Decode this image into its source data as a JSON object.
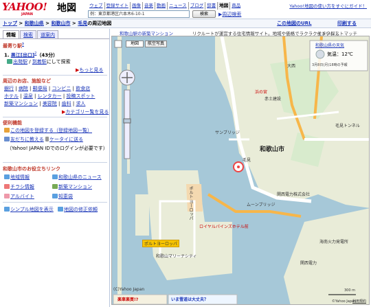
{
  "header": {
    "logo_text": "YAHOO!",
    "logo_sub": "JAPAN",
    "service": "地図",
    "nav": [
      "ウェブ",
      "登録サイト",
      "画像",
      "音楽",
      "動画",
      "ニュース",
      "ブログ",
      "辞書",
      "地図",
      "商品"
    ],
    "nav_current": "地図",
    "help_link": "Yahoo!地図の使い方をすぐにガイド！",
    "search_placeholder": "例：東京都港区六本木6-10-1",
    "search_button": "検索",
    "search_link": "周辺検索"
  },
  "breadcrumb": {
    "items": [
      "トップ",
      "和歌山県",
      "和歌山市",
      "毛見"
    ],
    "current": "の周辺地図"
  },
  "toolbar": {
    "url_button": "この地図のURL",
    "print_button": "印刷する"
  },
  "left": {
    "tabs": [
      "情報",
      "検索",
      "道案内"
    ],
    "station": {
      "heading": "最寄り駅",
      "help": "?",
      "item_num": "1.",
      "item_name": "黒江[出口]",
      "item_badge": "2",
      "item_time": "（43分）",
      "depart": "出発駅",
      "arrive": "到着駅",
      "suffix": "にして探索",
      "more": "もっと見る"
    },
    "nearby": {
      "heading": "周辺のお店、施設など",
      "links": [
        [
          "銀行",
          "病院",
          "郵便局",
          "コンビニ",
          "飲食店"
        ],
        [
          "ホテル",
          "温泉",
          "レンタカー",
          "投稿スポット"
        ],
        [
          "新築マンション",
          "美容院",
          "歯科",
          "求人"
        ]
      ],
      "more": "カテゴリー覧を見る"
    },
    "tools": {
      "heading": "便利機能",
      "register": "この地図を登録する",
      "register_list": "（登録地図一覧）",
      "tell_friend": "友だちに教える",
      "send_mobile": "ケータイに送る",
      "note": "（Yahoo! JAPAN IDでのログインが必要です）"
    },
    "links": {
      "heading": "和歌山市のお役立ちリンク",
      "items": [
        "地域情報",
        "和歌山県のニュース",
        "チラシ情報",
        "新築マンション",
        "アルバイト",
        "知恵袋"
      ],
      "simple_map": "シンプル地図を表示",
      "report": "地図の修正依頼"
    }
  },
  "map": {
    "ad_label": "和歌山駅の新築マンション",
    "ad_text": "リクルートが運営する住宅情報サイト。地域や価格でラクラク住まい探し",
    "ad_tag": "インタレストマッチ",
    "btn_map": "地図",
    "btn_photo": "航空写真",
    "weather_title": "和歌山県の天気",
    "weather_temp": "気温：12℃",
    "weather_note": "3月8日(月)18時の予報",
    "labels": {
      "city": "和歌山市",
      "keen": "毛見",
      "oonishi": "大西",
      "kenmitunnel": "毛見トンネル",
      "akatsu": "赤土建設",
      "hamanomiya": "浜の宮",
      "porto": "ポルトヨーロッパ",
      "marina": "和歌山マリーナシティ",
      "bridge": "ムーンブリッジ",
      "sunbridge": "サンブリッジ",
      "royal": "ロイヤルパインズホテル前",
      "porto_eu": "ポルト\nヨーロッパ",
      "kankyo": "関西電力株式会社",
      "sekisui": "海南火力発電所",
      "kainan": "関西電力",
      "copyright": "(C)Yahoo Japan",
      "copyright2": "©Yahoo Japan",
      "scale": "300 m",
      "terms": "利用規約"
    },
    "ads": [
      "楽車楽買!?",
      "いま雪道は大丈夫？"
    ]
  }
}
